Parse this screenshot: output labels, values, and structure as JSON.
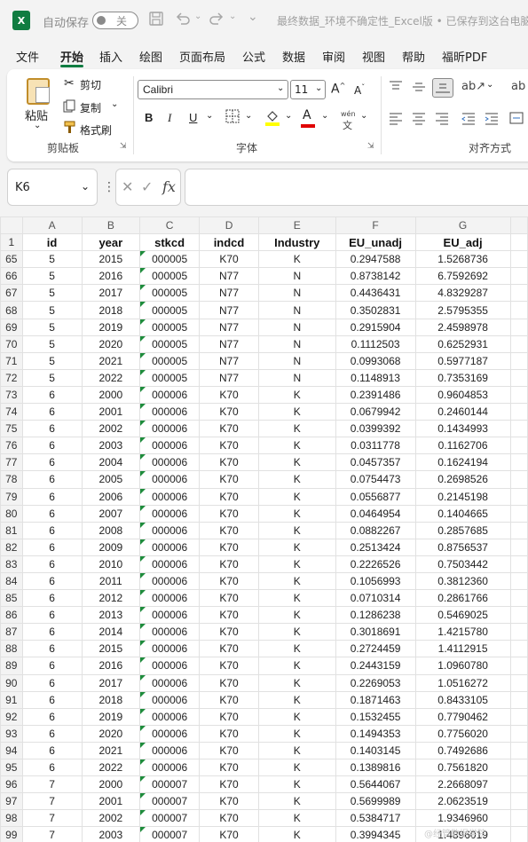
{
  "titlebar": {
    "app_icon": "X",
    "autosave_label": "自动保存",
    "autosave_state": "关",
    "document_title": "最终数据_环境不确定性_Excel版 • 已保存到这台电脑"
  },
  "menu": {
    "items": [
      "文件",
      "开始",
      "插入",
      "绘图",
      "页面布局",
      "公式",
      "数据",
      "审阅",
      "视图",
      "帮助",
      "福昕PDF"
    ],
    "active": "开始"
  },
  "ribbon": {
    "clipboard": {
      "paste": "粘贴",
      "cut": "剪切",
      "copy": "复制",
      "format_painter": "格式刷",
      "label": "剪贴板"
    },
    "font": {
      "name": "Calibri",
      "size": "11",
      "bold": "B",
      "italic": "I",
      "underline": "U",
      "font_color_glyph": "A",
      "wen_glyph": "wén",
      "label": "字体"
    },
    "alignment": {
      "label": "对齐方式"
    },
    "partial_right": "ab"
  },
  "formula_bar": {
    "cell_ref": "K6",
    "fx": "fx",
    "value": ""
  },
  "sheet": {
    "columns": [
      "A",
      "B",
      "C",
      "D",
      "E",
      "F",
      "G"
    ],
    "headers": [
      "id",
      "year",
      "stkcd",
      "indcd",
      "Industry",
      "EU_unadj",
      "EU_adj"
    ],
    "rows": [
      {
        "n": "65",
        "cells": [
          "5",
          "2015",
          "000005",
          "K70",
          "K",
          "0.2947588",
          "1.5268736"
        ]
      },
      {
        "n": "66",
        "cells": [
          "5",
          "2016",
          "000005",
          "N77",
          "N",
          "0.8738142",
          "6.7592692"
        ]
      },
      {
        "n": "67",
        "cells": [
          "5",
          "2017",
          "000005",
          "N77",
          "N",
          "0.4436431",
          "4.8329287"
        ]
      },
      {
        "n": "68",
        "cells": [
          "5",
          "2018",
          "000005",
          "N77",
          "N",
          "0.3502831",
          "2.5795355"
        ]
      },
      {
        "n": "69",
        "cells": [
          "5",
          "2019",
          "000005",
          "N77",
          "N",
          "0.2915904",
          "2.4598978"
        ]
      },
      {
        "n": "70",
        "cells": [
          "5",
          "2020",
          "000005",
          "N77",
          "N",
          "0.1112503",
          "0.6252931"
        ]
      },
      {
        "n": "71",
        "cells": [
          "5",
          "2021",
          "000005",
          "N77",
          "N",
          "0.0993068",
          "0.5977187"
        ]
      },
      {
        "n": "72",
        "cells": [
          "5",
          "2022",
          "000005",
          "N77",
          "N",
          "0.1148913",
          "0.7353169"
        ]
      },
      {
        "n": "73",
        "cells": [
          "6",
          "2000",
          "000006",
          "K70",
          "K",
          "0.2391486",
          "0.9604853"
        ]
      },
      {
        "n": "74",
        "cells": [
          "6",
          "2001",
          "000006",
          "K70",
          "K",
          "0.0679942",
          "0.2460144"
        ]
      },
      {
        "n": "75",
        "cells": [
          "6",
          "2002",
          "000006",
          "K70",
          "K",
          "0.0399392",
          "0.1434993"
        ]
      },
      {
        "n": "76",
        "cells": [
          "6",
          "2003",
          "000006",
          "K70",
          "K",
          "0.0311778",
          "0.1162706"
        ]
      },
      {
        "n": "77",
        "cells": [
          "6",
          "2004",
          "000006",
          "K70",
          "K",
          "0.0457357",
          "0.1624194"
        ]
      },
      {
        "n": "78",
        "cells": [
          "6",
          "2005",
          "000006",
          "K70",
          "K",
          "0.0754473",
          "0.2698526"
        ]
      },
      {
        "n": "79",
        "cells": [
          "6",
          "2006",
          "000006",
          "K70",
          "K",
          "0.0556877",
          "0.2145198"
        ]
      },
      {
        "n": "80",
        "cells": [
          "6",
          "2007",
          "000006",
          "K70",
          "K",
          "0.0464954",
          "0.1404665"
        ]
      },
      {
        "n": "81",
        "cells": [
          "6",
          "2008",
          "000006",
          "K70",
          "K",
          "0.0882267",
          "0.2857685"
        ]
      },
      {
        "n": "82",
        "cells": [
          "6",
          "2009",
          "000006",
          "K70",
          "K",
          "0.2513424",
          "0.8756537"
        ]
      },
      {
        "n": "83",
        "cells": [
          "6",
          "2010",
          "000006",
          "K70",
          "K",
          "0.2226526",
          "0.7503442"
        ]
      },
      {
        "n": "84",
        "cells": [
          "6",
          "2011",
          "000006",
          "K70",
          "K",
          "0.1056993",
          "0.3812360"
        ]
      },
      {
        "n": "85",
        "cells": [
          "6",
          "2012",
          "000006",
          "K70",
          "K",
          "0.0710314",
          "0.2861766"
        ]
      },
      {
        "n": "86",
        "cells": [
          "6",
          "2013",
          "000006",
          "K70",
          "K",
          "0.1286238",
          "0.5469025"
        ]
      },
      {
        "n": "87",
        "cells": [
          "6",
          "2014",
          "000006",
          "K70",
          "K",
          "0.3018691",
          "1.4215780"
        ]
      },
      {
        "n": "88",
        "cells": [
          "6",
          "2015",
          "000006",
          "K70",
          "K",
          "0.2724459",
          "1.4112915"
        ]
      },
      {
        "n": "89",
        "cells": [
          "6",
          "2016",
          "000006",
          "K70",
          "K",
          "0.2443159",
          "1.0960780"
        ]
      },
      {
        "n": "90",
        "cells": [
          "6",
          "2017",
          "000006",
          "K70",
          "K",
          "0.2269053",
          "1.0516272"
        ]
      },
      {
        "n": "91",
        "cells": [
          "6",
          "2018",
          "000006",
          "K70",
          "K",
          "0.1871463",
          "0.8433105"
        ]
      },
      {
        "n": "92",
        "cells": [
          "6",
          "2019",
          "000006",
          "K70",
          "K",
          "0.1532455",
          "0.7790462"
        ]
      },
      {
        "n": "93",
        "cells": [
          "6",
          "2020",
          "000006",
          "K70",
          "K",
          "0.1494353",
          "0.7756020"
        ]
      },
      {
        "n": "94",
        "cells": [
          "6",
          "2021",
          "000006",
          "K70",
          "K",
          "0.1403145",
          "0.7492686"
        ]
      },
      {
        "n": "95",
        "cells": [
          "6",
          "2022",
          "000006",
          "K70",
          "K",
          "0.1389816",
          "0.7561820"
        ]
      },
      {
        "n": "96",
        "cells": [
          "7",
          "2000",
          "000007",
          "K70",
          "K",
          "0.5644067",
          "2.2668097"
        ]
      },
      {
        "n": "97",
        "cells": [
          "7",
          "2001",
          "000007",
          "K70",
          "K",
          "0.5699989",
          "2.0623519"
        ]
      },
      {
        "n": "98",
        "cells": [
          "7",
          "2002",
          "000007",
          "K70",
          "K",
          "0.5384717",
          "1.9346960"
        ]
      },
      {
        "n": "99",
        "cells": [
          "7",
          "2003",
          "000007",
          "K70",
          "K",
          "0.3994345",
          "1.4896019"
        ]
      }
    ]
  },
  "colors": {
    "excel_green": "#107c41",
    "text_indicator": "#1e8c3c"
  }
}
